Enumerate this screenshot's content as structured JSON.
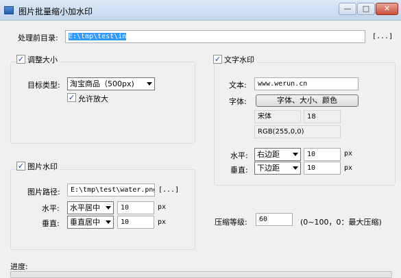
{
  "window": {
    "title": "图片批量缩小加水印",
    "minimize_label": "—",
    "maximize_label": "□",
    "close_label": "✕"
  },
  "source": {
    "label": "处理前目录:",
    "value": "E:\\tmp\\test\\in",
    "browse_label": "[...]"
  },
  "resize": {
    "checkbox_label": "调整大小",
    "checked": true,
    "target_type_label": "目标类型:",
    "target_type_value": "淘宝商品（500px)",
    "allow_enlarge_label": "允许放大",
    "allow_enlarge_checked": true
  },
  "text_watermark": {
    "checkbox_label": "文字水印",
    "checked": true,
    "text_label": "文本:",
    "text_value": "www.werun.cn",
    "font_label": "字体:",
    "font_button_label": "字体、大小、颜色",
    "font_name": "宋体",
    "font_size": "18",
    "font_color": "RGB(255,0,0)",
    "horizontal_label": "水平:",
    "horizontal_value": "右边距",
    "horizontal_offset": "10",
    "vertical_label": "垂直:",
    "vertical_value": "下边距",
    "vertical_offset": "10",
    "unit": "px"
  },
  "image_watermark": {
    "checkbox_label": "图片水印",
    "checked": true,
    "path_label": "图片路径:",
    "path_value": "E:\\tmp\\test\\water.png",
    "browse_label": "[...]",
    "horizontal_label": "水平:",
    "horizontal_value": "水平居中",
    "horizontal_offset": "10",
    "vertical_label": "垂直:",
    "vertical_value": "垂直居中",
    "vertical_offset": "10",
    "unit": "px"
  },
  "compression": {
    "label": "压缩等级:",
    "value": "60",
    "hint": "(0~100，0：最大压缩)"
  },
  "progress": {
    "label": "进度:"
  },
  "check_mark": "✓"
}
